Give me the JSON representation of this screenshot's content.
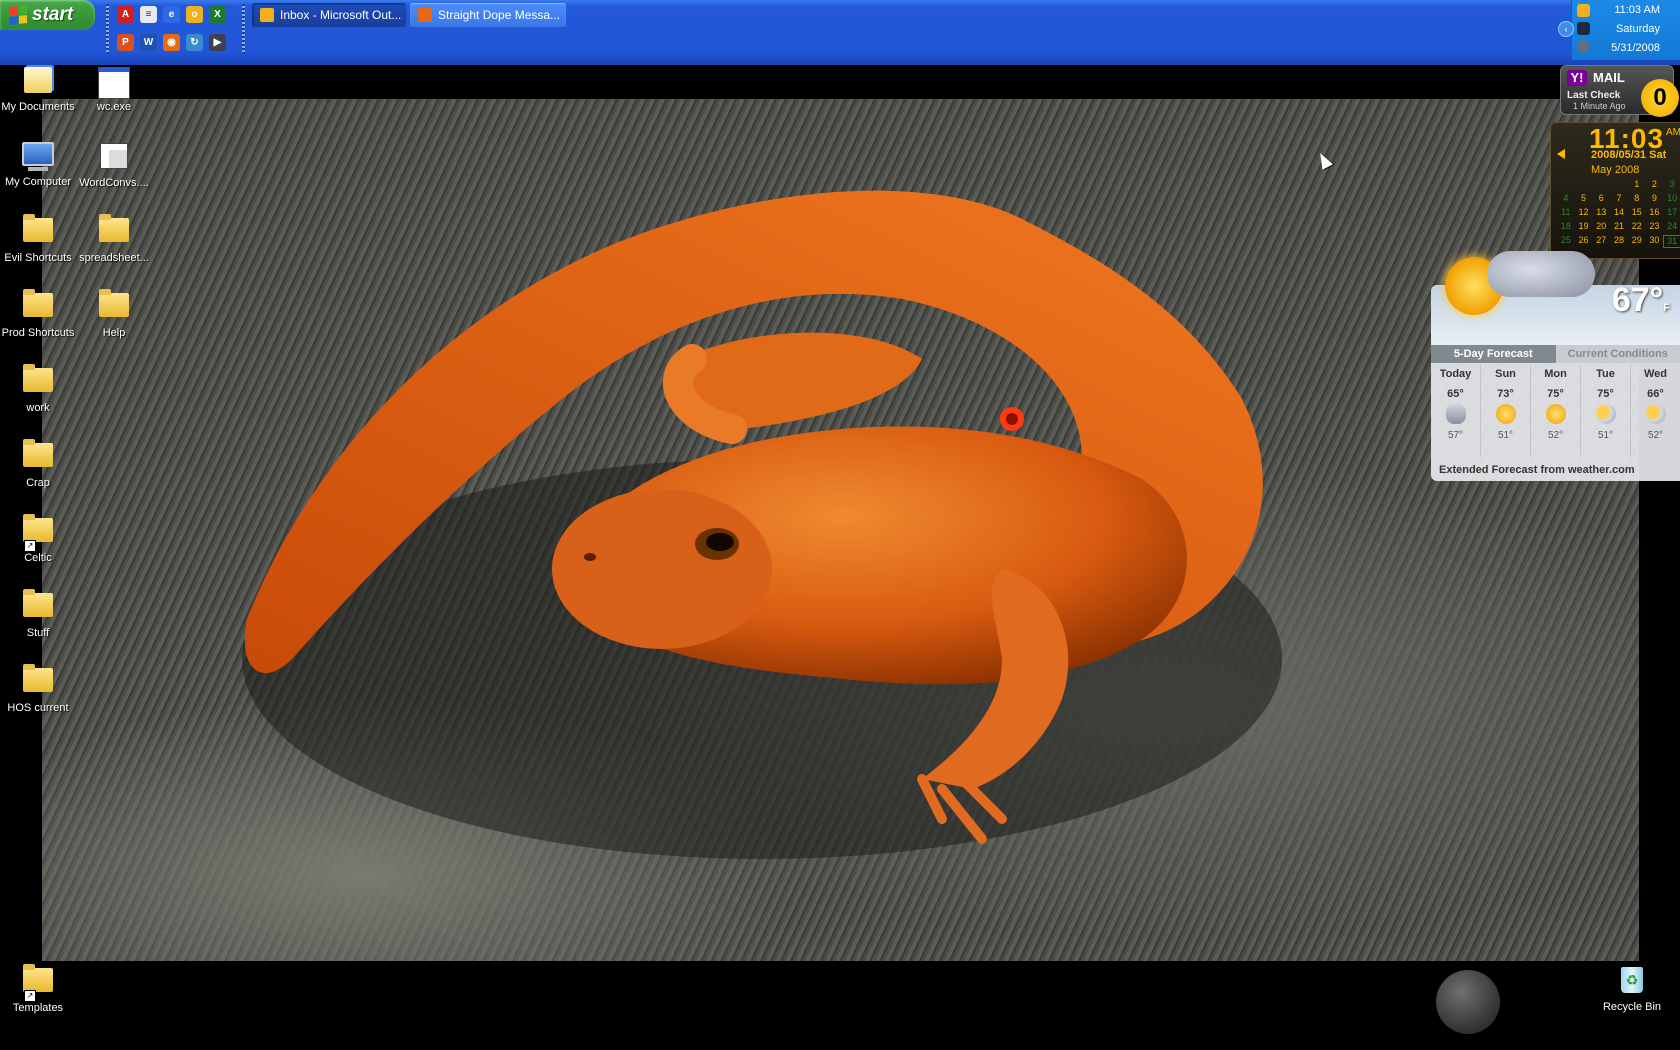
{
  "taskbar": {
    "start_label": "start",
    "quick_launch": [
      {
        "name": "acrobat-icon",
        "color": "#d02020",
        "glyph": "A"
      },
      {
        "name": "notepad-icon",
        "color": "#e8e8f0",
        "glyph": "≡"
      },
      {
        "name": "internet-explorer-icon",
        "color": "#2a6ae8",
        "glyph": "e"
      },
      {
        "name": "outlook-icon",
        "color": "#f0b020",
        "glyph": "o"
      },
      {
        "name": "excel-icon",
        "color": "#1e7a2e",
        "glyph": "X"
      },
      {
        "name": "powerpoint-icon",
        "color": "#d85020",
        "glyph": "P"
      },
      {
        "name": "word-icon",
        "color": "#2050b0",
        "glyph": "W"
      },
      {
        "name": "firefox-icon",
        "color": "#e86a10",
        "glyph": "◉"
      },
      {
        "name": "sync-icon",
        "color": "#3a8ad0",
        "glyph": "↻"
      },
      {
        "name": "media-player-icon",
        "color": "#404050",
        "glyph": "▶"
      }
    ],
    "tasks": [
      {
        "label": "Inbox - Microsoft Out...",
        "icon_color": "#f0b020",
        "active": true
      },
      {
        "label": "Straight Dope Messa...",
        "icon_color": "#e86a10",
        "active": false
      }
    ],
    "tray": {
      "time": "11:03 AM",
      "day": "Saturday",
      "date": "5/31/2008",
      "expand_glyph": "‹"
    }
  },
  "desktop_icons": [
    {
      "name": "desktop-icon-my-documents",
      "label": "My Documents",
      "type": "documents"
    },
    {
      "name": "desktop-icon-wc-exe",
      "label": "wc.exe",
      "type": "exe"
    },
    {
      "name": "desktop-icon-my-computer",
      "label": "My Computer",
      "type": "computer"
    },
    {
      "name": "desktop-icon-wordconvs",
      "label": "WordConvs....",
      "type": "exe2"
    },
    {
      "name": "desktop-icon-evil-shortcuts",
      "label": "Evil Shortcuts",
      "type": "folder"
    },
    {
      "name": "desktop-icon-spreadsheet",
      "label": "spreadsheet...",
      "type": "folder"
    },
    {
      "name": "desktop-icon-prod-shortcuts",
      "label": "Prod Shortcuts",
      "type": "folder"
    },
    {
      "name": "desktop-icon-help",
      "label": "Help",
      "type": "folder"
    },
    {
      "name": "desktop-icon-work",
      "label": "work",
      "type": "folder"
    },
    {
      "name": "desktop-icon-crap",
      "label": "Crap",
      "type": "folder"
    },
    {
      "name": "desktop-icon-celtic",
      "label": "Celtic",
      "type": "folder-shortcut"
    },
    {
      "name": "desktop-icon-stuff",
      "label": "Stuff",
      "type": "folder"
    },
    {
      "name": "desktop-icon-hos-current",
      "label": "HOS current",
      "type": "folder"
    },
    {
      "name": "desktop-icon-templates",
      "label": "Templates",
      "type": "folder-shortcut"
    },
    {
      "name": "desktop-icon-recycle-bin",
      "label": "Recycle Bin",
      "type": "recycle"
    }
  ],
  "yahoo_mail": {
    "logo": "Y!",
    "title": "MAIL",
    "last_check": "Last Check",
    "ago": "1 Minute Ago",
    "count": "0"
  },
  "clock_gadget": {
    "time": "11:03",
    "ampm": "AM",
    "date": "2008/05/31 Sat",
    "month": "May 2008",
    "calendar": [
      "",
      "",
      "",
      "",
      "1",
      "2",
      "3",
      "4",
      "5",
      "6",
      "7",
      "8",
      "9",
      "10",
      "11",
      "12",
      "13",
      "14",
      "15",
      "16",
      "17",
      "18",
      "19",
      "20",
      "21",
      "22",
      "23",
      "24",
      "25",
      "26",
      "27",
      "28",
      "29",
      "30",
      "31"
    ],
    "today": "31"
  },
  "weather": {
    "current_temp": "67°",
    "unit": "F",
    "tab_forecast": "5-Day Forecast",
    "tab_current": "Current Conditions",
    "days": [
      {
        "day": "Today",
        "hi": "65°",
        "lo": "57°",
        "cond": "rain"
      },
      {
        "day": "Sun",
        "hi": "73°",
        "lo": "51°",
        "cond": "sun"
      },
      {
        "day": "Mon",
        "hi": "75°",
        "lo": "52°",
        "cond": "sun"
      },
      {
        "day": "Tue",
        "hi": "75°",
        "lo": "51°",
        "cond": "pcloud"
      },
      {
        "day": "Wed",
        "hi": "66°",
        "lo": "52°",
        "cond": "pcloud"
      }
    ],
    "footer": "Extended Forecast from weather.com"
  },
  "colors": {
    "taskbar": "#2156d6",
    "start_green": "#3a9a38",
    "salamander_orange": "#e06010",
    "clock_amber": "#ffb800"
  }
}
